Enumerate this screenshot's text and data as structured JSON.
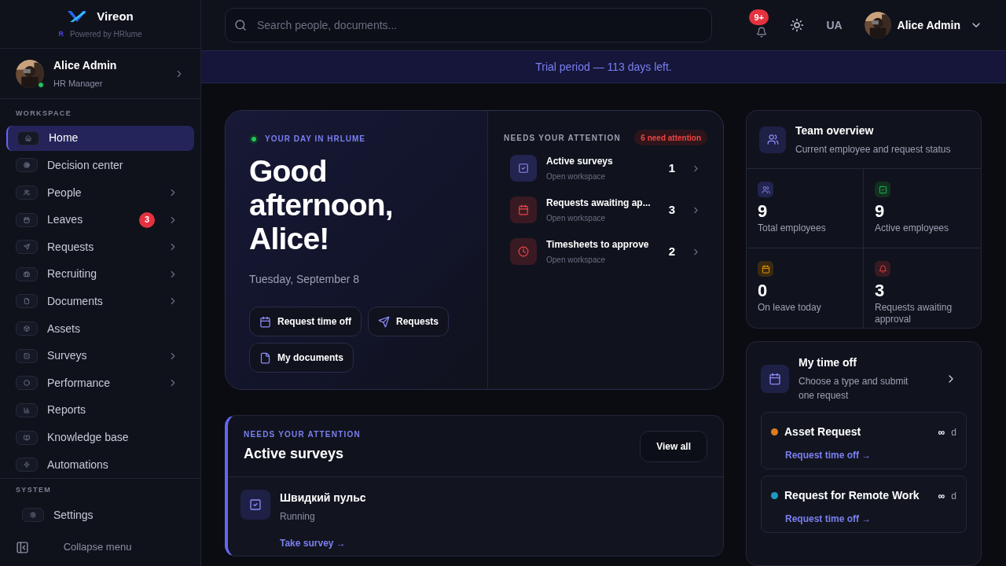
{
  "brand": {
    "name": "Vireon",
    "powered_by": "Powered by HRlume",
    "powered_mark": "R"
  },
  "profile": {
    "name": "Alice Admin",
    "role": "HR Manager",
    "online": true
  },
  "workspace_label": "WORKSPACE",
  "nav": [
    {
      "label": "Home",
      "selected": true,
      "chevron": false
    },
    {
      "label": "Decision center",
      "selected": false,
      "chevron": false
    },
    {
      "label": "People",
      "selected": false,
      "chevron": true
    },
    {
      "label": "Leaves",
      "selected": false,
      "chevron": true,
      "badge": "3"
    },
    {
      "label": "Requests",
      "selected": false,
      "chevron": true
    },
    {
      "label": "Recruiting",
      "selected": false,
      "chevron": true
    },
    {
      "label": "Documents",
      "selected": false,
      "chevron": true
    },
    {
      "label": "Assets",
      "selected": false,
      "chevron": false
    },
    {
      "label": "Surveys",
      "selected": false,
      "chevron": true
    },
    {
      "label": "Performance",
      "selected": false,
      "chevron": true
    },
    {
      "label": "Reports",
      "selected": false,
      "chevron": false
    },
    {
      "label": "Knowledge base",
      "selected": false,
      "chevron": false
    },
    {
      "label": "Automations",
      "selected": false,
      "chevron": false
    }
  ],
  "system_label": "SYSTEM",
  "system_nav": [
    {
      "label": "Settings",
      "selected": false,
      "chevron": false
    }
  ],
  "collapse_label": "Collapse menu",
  "header": {
    "search_placeholder": "Search people, documents...",
    "notifications": "9+",
    "language": "UA",
    "user": "Alice Admin"
  },
  "trial_banner": "Trial period — 113 days left.",
  "hero": {
    "eyebrow": "YOUR DAY IN HRLUME",
    "greeting": "Good afternoon, Alice!",
    "date": "Tuesday, September 8",
    "actions": [
      {
        "label": "Request time off"
      },
      {
        "label": "Requests"
      },
      {
        "label": "My documents"
      }
    ],
    "attention_title": "NEEDS YOUR ATTENTION",
    "attention_badge": "6 need attention",
    "attention": [
      {
        "title": "Active surveys",
        "subtitle": "Open workspace",
        "count": "1",
        "kind": "survey"
      },
      {
        "title": "Requests awaiting ap...",
        "subtitle": "Open workspace",
        "count": "3",
        "kind": "request"
      },
      {
        "title": "Timesheets to approve",
        "subtitle": "Open workspace",
        "count": "2",
        "kind": "timesheet"
      }
    ]
  },
  "surveys": {
    "eyebrow": "NEEDS YOUR ATTENTION",
    "title": "Active surveys",
    "view_all": "View all",
    "items": [
      {
        "title": "Швидкий пульс",
        "status": "Running",
        "action": "Take survey →"
      }
    ]
  },
  "team": {
    "title": "Team overview",
    "subtitle": "Current employee and request status",
    "stats": [
      {
        "value": "9",
        "label": "Total employees",
        "kind": "people"
      },
      {
        "value": "9",
        "label": "Active employees",
        "kind": "active"
      },
      {
        "value": "0",
        "label": "On leave today",
        "kind": "leave"
      },
      {
        "value": "3",
        "label": "Requests awaiting approval",
        "kind": "alert"
      }
    ]
  },
  "time_off": {
    "title": "My time off",
    "subtitle": "Choose a type and submit one request",
    "types": [
      {
        "name": "Asset Request",
        "balance": "∞",
        "unit": "d",
        "action": "Request time off →",
        "color": "#e07a1f"
      },
      {
        "name": "Request for Remote Work",
        "balance": "∞",
        "unit": "d",
        "action": "Request time off →",
        "color": "#1f9bbf"
      }
    ]
  }
}
